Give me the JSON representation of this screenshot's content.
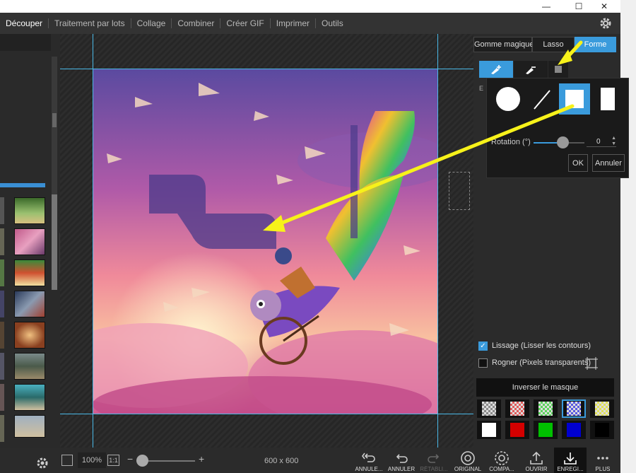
{
  "window": {
    "controls": {
      "minimize": "—",
      "maximize": "☐",
      "close": "✕"
    }
  },
  "menu": {
    "items": [
      {
        "label": "Découper",
        "active": true
      },
      {
        "label": "Traitement par lots",
        "active": false
      },
      {
        "label": "Collage",
        "active": false
      },
      {
        "label": "Combiner",
        "active": false
      },
      {
        "label": "Créer GIF",
        "active": false
      },
      {
        "label": "Imprimer",
        "active": false
      },
      {
        "label": "Outils",
        "active": false
      }
    ],
    "settings_icon": "gear-icon"
  },
  "tool_tabs": [
    {
      "label": "Gomme magique",
      "active": false
    },
    {
      "label": "Lasso",
      "active": false
    },
    {
      "label": "Forme",
      "active": true
    }
  ],
  "shape_popup": {
    "shapes": [
      "circle",
      "line",
      "square",
      "rectangle"
    ],
    "selected": "square",
    "rotation_label": "Rotation (°)",
    "rotation_value": "0",
    "ok_label": "OK",
    "cancel_label": "Annuler"
  },
  "options": {
    "smooth": {
      "label": "Lissage (Lisser les contours)",
      "checked": true
    },
    "crop": {
      "label": "Rogner (Pixels transparents)",
      "checked": false
    }
  },
  "invert_label": "Inverser le masque",
  "swatches": [
    {
      "color": "#8a8a8a",
      "type": "checker",
      "selected": false
    },
    {
      "color": "#e05a5a",
      "type": "checker",
      "selected": false
    },
    {
      "color": "#5ad45a",
      "type": "checker",
      "selected": false
    },
    {
      "color": "#5a5ae0",
      "type": "checker",
      "selected": true
    },
    {
      "color": "#e0e05a",
      "type": "checker",
      "selected": false
    },
    {
      "color": "#ffffff",
      "type": "solid",
      "selected": false
    },
    {
      "color": "#d40000",
      "type": "solid",
      "selected": false
    },
    {
      "color": "#00c000",
      "type": "solid",
      "selected": false
    },
    {
      "color": "#0000d0",
      "type": "solid",
      "selected": false
    },
    {
      "color": "#000000",
      "type": "solid",
      "selected": false
    }
  ],
  "bottom": {
    "zoom": "100%",
    "ratio_button": "1:1",
    "zoom_minus": "−",
    "zoom_plus": "+",
    "zoom_level": 0.1,
    "image_size": "600 x 600",
    "actions": [
      {
        "label": "ANNULE...",
        "icon": "undo-all-icon",
        "enabled": true
      },
      {
        "label": "ANNULER",
        "icon": "undo-icon",
        "enabled": true
      },
      {
        "label": "RÉTABLI...",
        "icon": "redo-icon",
        "enabled": false
      },
      {
        "label": "ORIGINAL",
        "icon": "original-icon",
        "enabled": true
      },
      {
        "label": "COMPA...",
        "icon": "compare-icon",
        "enabled": true
      },
      {
        "label": "OUVRIR",
        "icon": "open-icon",
        "enabled": true
      },
      {
        "label": "ENREGI...",
        "icon": "save-icon",
        "enabled": true
      },
      {
        "label": "PLUS",
        "icon": "more-icon",
        "enabled": true
      }
    ]
  },
  "colors": {
    "accent": "#3a9bdc",
    "arrow": "#f7f21a",
    "guide": "#4ab9e8"
  }
}
